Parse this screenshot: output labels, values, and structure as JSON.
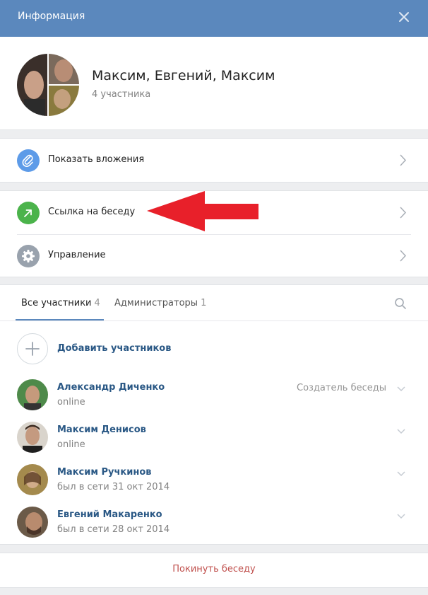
{
  "header": {
    "title": "Информация",
    "close_icon": "close-icon"
  },
  "chat": {
    "name": "Максим, Евгений, Максим",
    "members_count": "4 участника"
  },
  "actions": {
    "attachments": {
      "label": "Показать вложения",
      "icon": "paperclip-icon",
      "color": "#5d9be8"
    },
    "chat_link": {
      "label": "Ссылка на беседу",
      "icon": "arrow-up-right-icon",
      "color": "#4bb34b"
    },
    "manage": {
      "label": "Управление",
      "icon": "gear-icon",
      "color": "#99a2ad"
    }
  },
  "tabs": [
    {
      "label": "Все участники",
      "count": "4"
    },
    {
      "label": "Администраторы",
      "count": "1"
    }
  ],
  "add_members": {
    "label": "Добавить участников"
  },
  "members": [
    {
      "name": "Александр Диченко",
      "status": "online",
      "role": "Создатель беседы"
    },
    {
      "name": "Максим Денисов",
      "status": "online",
      "role": ""
    },
    {
      "name": "Максим Ручкинов",
      "status": "был в сети 31 окт 2014",
      "role": ""
    },
    {
      "name": "Евгений Макаренко",
      "status": "был в сети 28 окт 2014",
      "role": ""
    }
  ],
  "leave": {
    "label": "Покинуть беседу"
  },
  "colors": {
    "header": "#5b88bd",
    "link": "#2a5885",
    "leave": "#c0504d",
    "annotation_arrow": "#e8202a"
  }
}
